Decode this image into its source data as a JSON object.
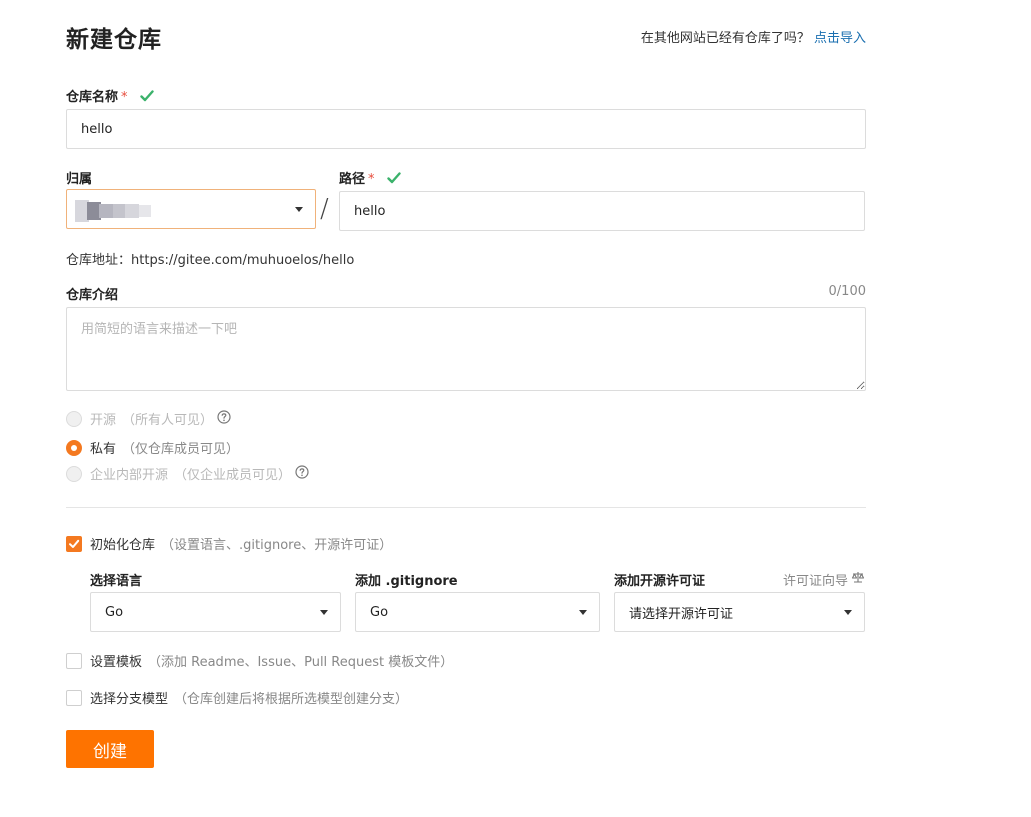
{
  "header": {
    "title": "新建仓库",
    "import_prompt": "在其他网站已经有仓库了吗？",
    "import_link": "点击导入"
  },
  "repo_name": {
    "label": "仓库名称",
    "required_mark": "*",
    "value": "hello"
  },
  "owner": {
    "label": "归属"
  },
  "path": {
    "label": "路径",
    "required_mark": "*",
    "separator": "/",
    "value": "hello"
  },
  "address": {
    "label": "仓库地址：",
    "url": "https://gitee.com/muhuoelos/hello"
  },
  "description": {
    "label": "仓库介绍",
    "counter": "0/100",
    "placeholder": "用简短的语言来描述一下吧"
  },
  "visibility": {
    "options": [
      {
        "label": "开源",
        "hint": "（所有人可见）",
        "selected": false,
        "disabled": true
      },
      {
        "label": "私有",
        "hint": "（仅仓库成员可见）",
        "selected": true,
        "disabled": false
      },
      {
        "label": "企业内部开源",
        "hint": "（仅企业成员可见）",
        "selected": false,
        "disabled": true
      }
    ]
  },
  "init_repo": {
    "label": "初始化仓库",
    "hint": "（设置语言、.gitignore、开源许可证）",
    "checked": true
  },
  "language": {
    "label": "选择语言",
    "value": "Go"
  },
  "gitignore": {
    "label": "添加 .gitignore",
    "value": "Go"
  },
  "license": {
    "label": "添加开源许可证",
    "wizard": "许可证向导",
    "value": "请选择开源许可证"
  },
  "template": {
    "label": "设置模板",
    "hint": "（添加 Readme、Issue、Pull Request 模板文件）",
    "checked": false
  },
  "branch_model": {
    "label": "选择分支模型",
    "hint": "（仓库创建后将根据所选模型创建分支）",
    "checked": false
  },
  "submit": {
    "label": "创建"
  },
  "colors": {
    "accent": "#fe7300",
    "link": "#1a6fb0",
    "success": "#3bb26b"
  }
}
